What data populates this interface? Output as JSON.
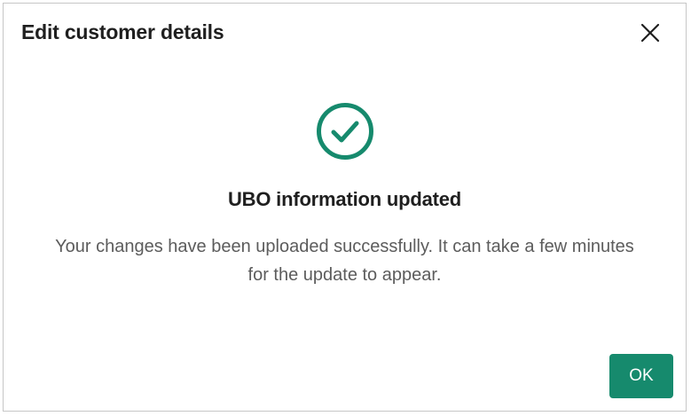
{
  "dialog": {
    "title": "Edit customer details",
    "close_icon": "close-icon",
    "status_icon": "check-circle-icon",
    "heading": "UBO information updated",
    "message": "Your changes have been uploaded successfully. It can take a few minutes for the update to appear.",
    "ok_label": "OK"
  },
  "colors": {
    "accent": "#168a6d",
    "title_text": "#1f1f1f",
    "body_text": "#5c5c5c",
    "border": "#c6c6c6"
  }
}
